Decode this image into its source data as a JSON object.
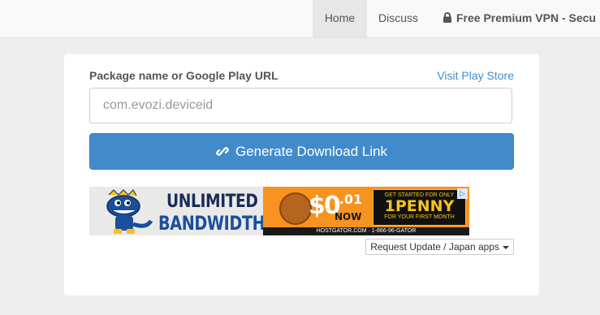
{
  "nav": {
    "home": "Home",
    "discuss": "Discuss",
    "vpn": "Free Premium VPN - Secu"
  },
  "form": {
    "label": "Package name or Google Play URL",
    "play_link": "Visit Play Store",
    "input_value": "",
    "input_placeholder": "com.evozi.deviceid",
    "generate_label": "Generate Download Link"
  },
  "ad": {
    "line1": "UNLIMITED",
    "line2": "BANDWIDTH",
    "price": "$0",
    "price_cents": ".01",
    "now": "NOW",
    "promo_top": "GET STARTED FOR ONLY",
    "promo_mid": "1PENNY",
    "promo_bot": "FOR YOUR FIRST MONTH",
    "footer": "HOSTGATOR.COM  ·  1-866-96-GATOR"
  },
  "request_button": "Request Update / Japan apps",
  "colors": {
    "primary": "#428bca",
    "link": "#428bca",
    "ad_orange": "#f7931e"
  },
  "icons": {
    "vpn": "lock-icon",
    "generate": "link-icon",
    "request": "caret-down-icon",
    "ad": "adchoices-icon"
  }
}
